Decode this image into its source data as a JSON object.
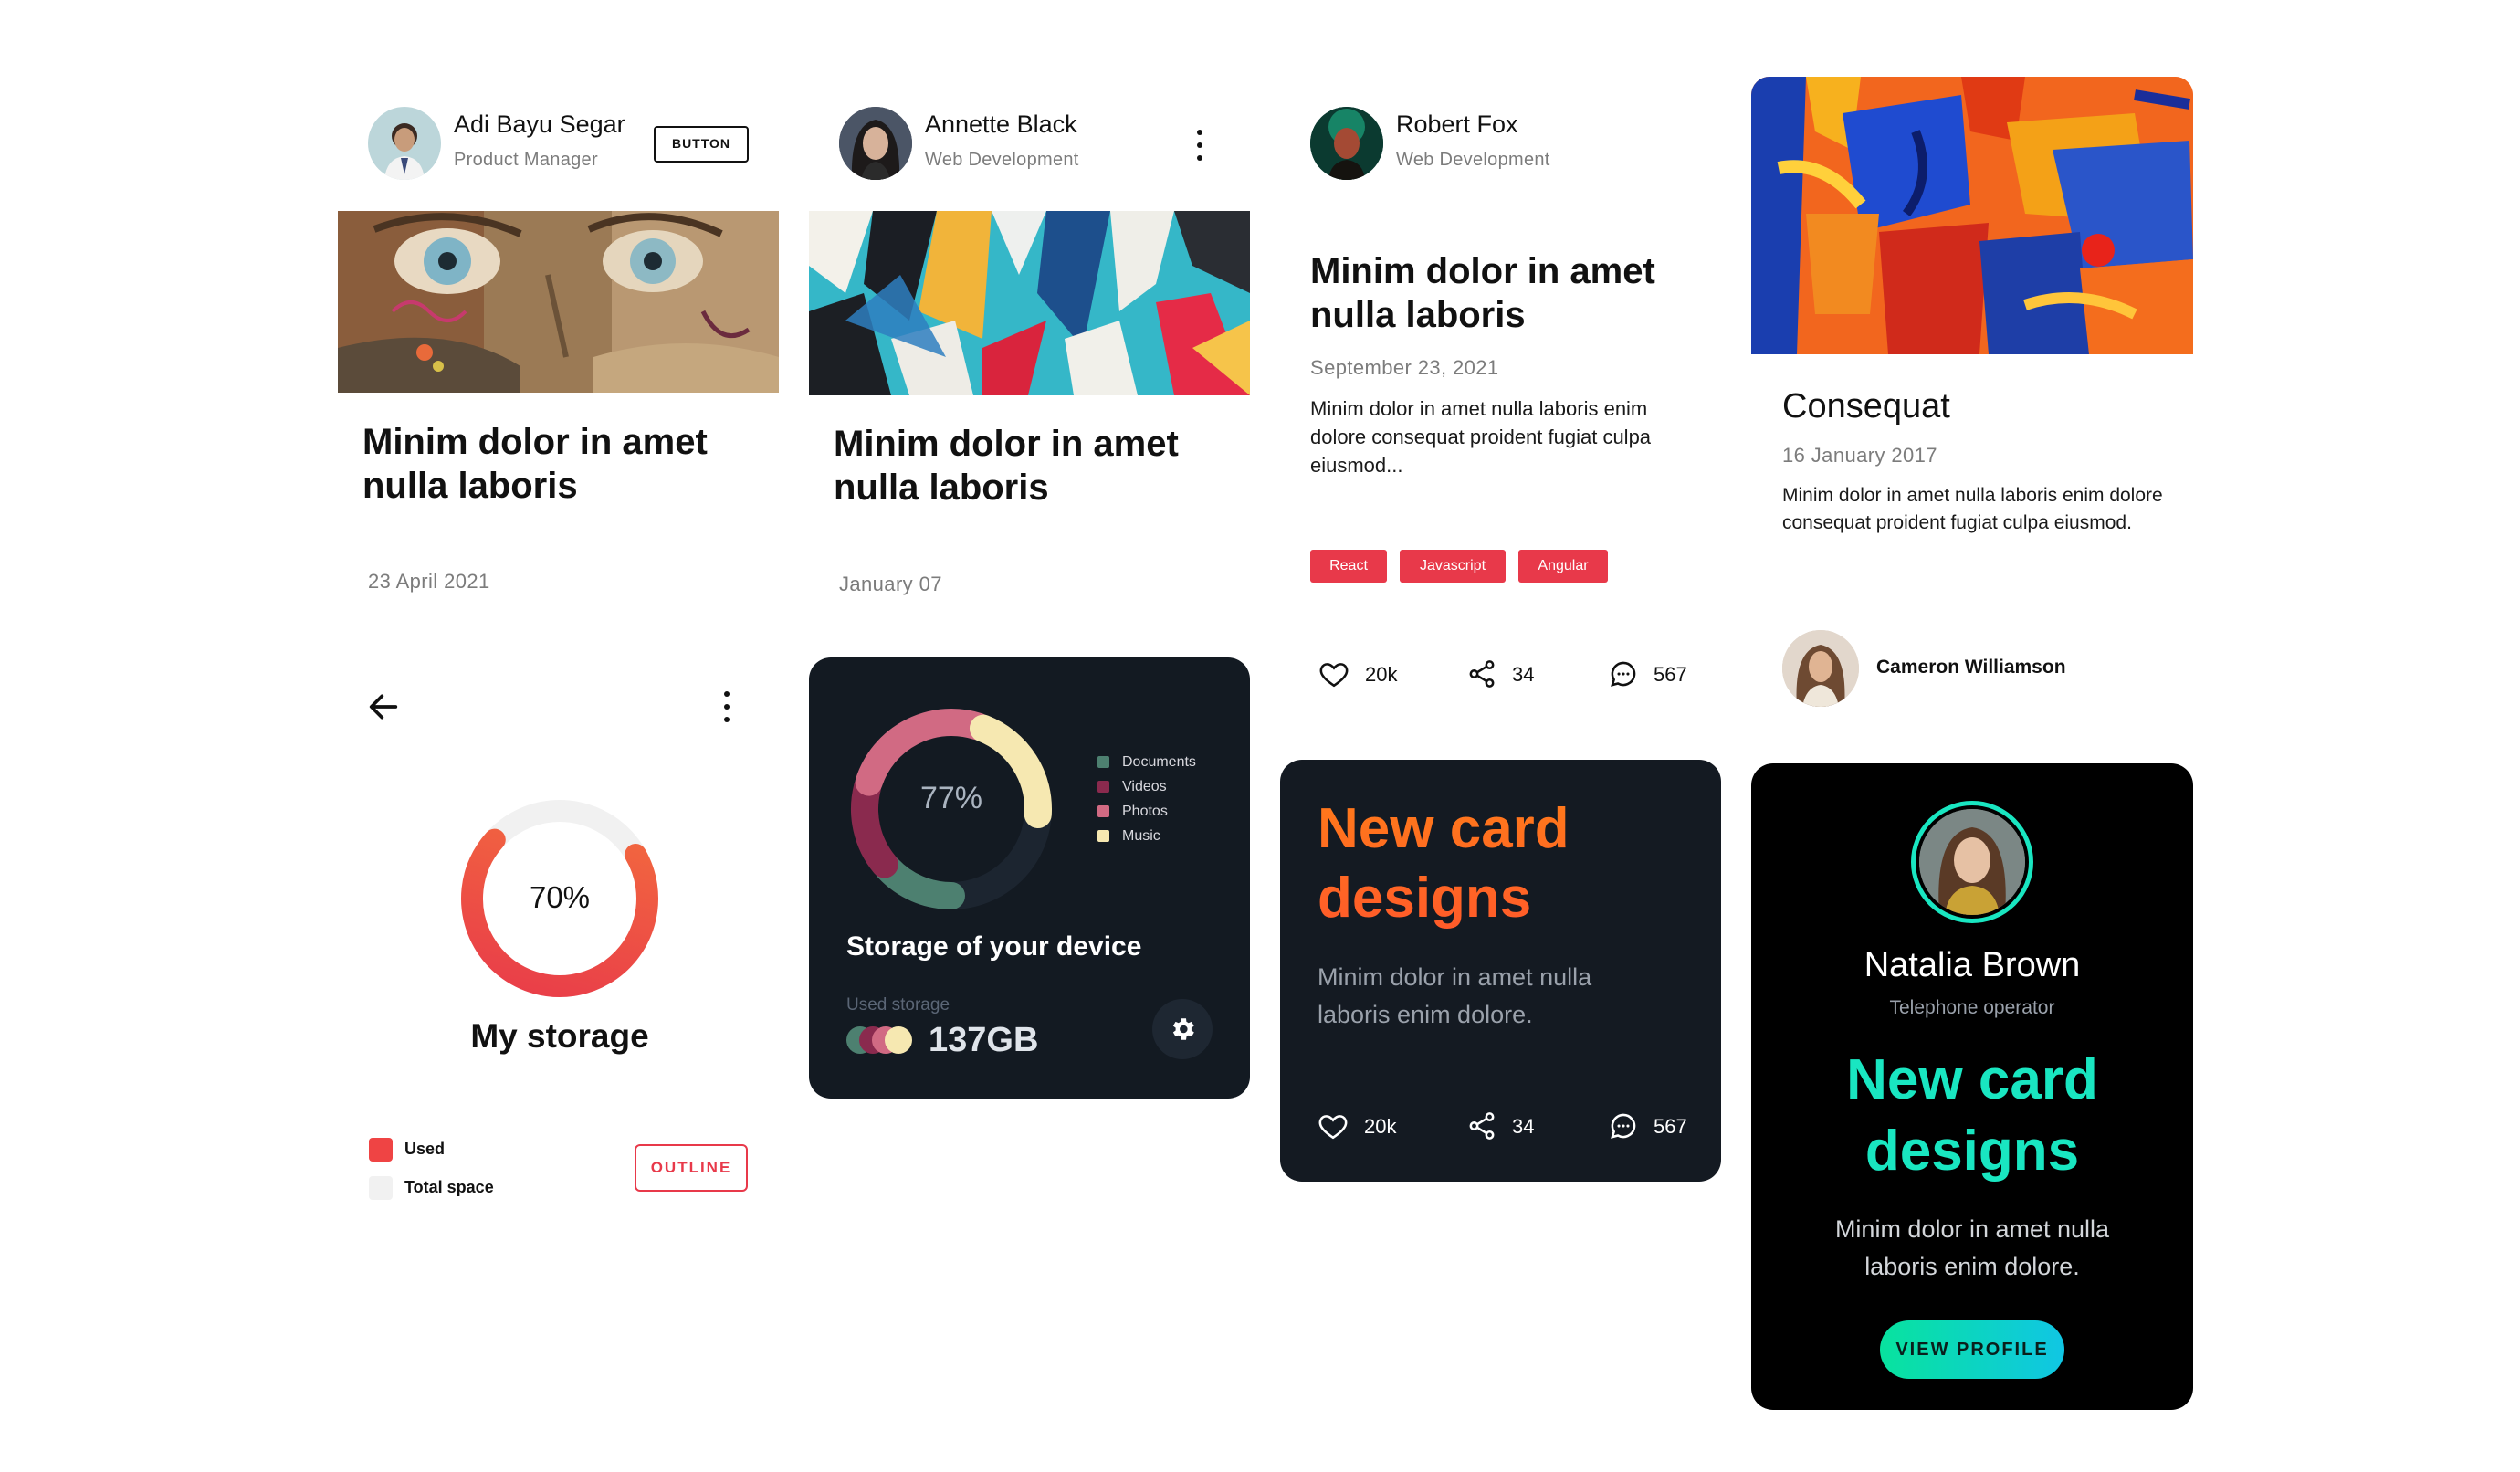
{
  "card1": {
    "author_name": "Adi Bayu Segar",
    "author_role": "Product Manager",
    "button_label": "BUTTON",
    "title": "Minim dolor in amet nulla laboris",
    "date": "23 April 2021"
  },
  "card2": {
    "author_name": "Annette Black",
    "author_role": "Web Development",
    "title": "Minim dolor in amet nulla laboris",
    "date": "January 07"
  },
  "card3": {
    "author_name": "Robert Fox",
    "author_role": "Web Development",
    "title": "Minim dolor in amet nulla laboris",
    "date": "September 23, 2021",
    "excerpt": "Minim dolor in amet nulla laboris enim dolore consequat proident fugiat culpa eiusmod...",
    "tags": [
      "React",
      "Javascript",
      "Angular"
    ],
    "stats": {
      "likes": "20k",
      "shares": "34",
      "comments": "567"
    }
  },
  "card4": {
    "title": "Consequat",
    "date": "16 January 2017",
    "excerpt": "Minim dolor in amet nulla laboris enim dolore consequat proident fugiat culpa eiusmod.",
    "author_name": "Cameron Williamson"
  },
  "storage_light": {
    "percent_label": "70%",
    "percent": 0.7,
    "title": "My storage",
    "legend": [
      {
        "label": "Used",
        "color": "#ef4444"
      },
      {
        "label": "Total space",
        "color": "#f1f1f1"
      }
    ],
    "button_label": "OUTLINE"
  },
  "storage_dark": {
    "percent_label": "77%",
    "legend": [
      {
        "label": "Documents",
        "color": "#4d8070",
        "share": 0.14
      },
      {
        "label": "Videos",
        "color": "#8a2a4e",
        "share": 0.16
      },
      {
        "label": "Photos",
        "color": "#d16a83",
        "share": 0.26
      },
      {
        "label": "Music",
        "color": "#f6e8b1",
        "share": 0.21
      }
    ],
    "title": "Storage of your device",
    "used_label": "Used storage",
    "used_value": "137GB"
  },
  "new_card_dark": {
    "headline": "New card designs",
    "body": "Minim dolor in amet nulla laboris enim dolore.",
    "stats": {
      "likes": "20k",
      "shares": "34",
      "comments": "567"
    }
  },
  "profile_card": {
    "name": "Natalia Brown",
    "role": "Telephone operator",
    "headline": "New card designs",
    "body": "Minim dolor in amet nulla laboris enim dolore.",
    "button_label": "VIEW PROFILE"
  },
  "colors": {
    "accent_red": "#e8394a",
    "dark_bg": "#111820",
    "gradient_orange_start": "#ff7a1a",
    "gradient_teal": "#19e6c1"
  }
}
